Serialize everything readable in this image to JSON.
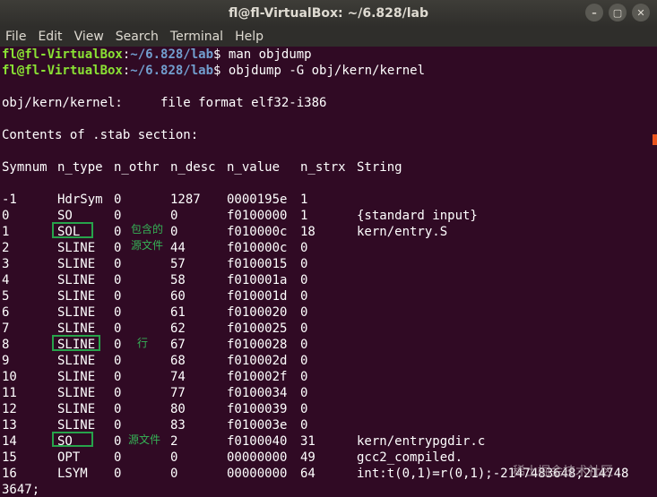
{
  "window": {
    "title": "fl@fl-VirtualBox: ~/6.828/lab",
    "controls": [
      "–",
      "▢",
      "✕"
    ]
  },
  "menu": [
    "File",
    "Edit",
    "View",
    "Search",
    "Terminal",
    "Help"
  ],
  "prompt": {
    "user": "fl@fl-VirtualBox",
    "sep": ":",
    "path": "~/6.828/lab",
    "symbol": "$"
  },
  "commands": [
    "man objdump",
    "objdump -G obj/kern/kernel"
  ],
  "output": {
    "file_line": "obj/kern/kernel:     file format elf32-i386",
    "section_line": "Contents of .stab section:",
    "headers": [
      "Symnum",
      "n_type",
      "n_othr",
      "n_desc",
      "n_value",
      "n_strx",
      "String"
    ],
    "rows": [
      [
        "-1",
        "HdrSym",
        "0",
        "1287",
        "0000195e",
        "1",
        ""
      ],
      [
        "0",
        "SO",
        "0",
        "0",
        "f0100000",
        "1",
        "{standard input}"
      ],
      [
        "1",
        "SOL",
        "0",
        "0",
        "f010000c",
        "18",
        "kern/entry.S"
      ],
      [
        "2",
        "SLINE",
        "0",
        "44",
        "f010000c",
        "0",
        ""
      ],
      [
        "3",
        "SLINE",
        "0",
        "57",
        "f0100015",
        "0",
        ""
      ],
      [
        "4",
        "SLINE",
        "0",
        "58",
        "f010001a",
        "0",
        ""
      ],
      [
        "5",
        "SLINE",
        "0",
        "60",
        "f010001d",
        "0",
        ""
      ],
      [
        "6",
        "SLINE",
        "0",
        "61",
        "f0100020",
        "0",
        ""
      ],
      [
        "7",
        "SLINE",
        "0",
        "62",
        "f0100025",
        "0",
        ""
      ],
      [
        "8",
        "SLINE",
        "0",
        "67",
        "f0100028",
        "0",
        ""
      ],
      [
        "9",
        "SLINE",
        "0",
        "68",
        "f010002d",
        "0",
        ""
      ],
      [
        "10",
        "SLINE",
        "0",
        "74",
        "f010002f",
        "0",
        ""
      ],
      [
        "11",
        "SLINE",
        "0",
        "77",
        "f0100034",
        "0",
        ""
      ],
      [
        "12",
        "SLINE",
        "0",
        "80",
        "f0100039",
        "0",
        ""
      ],
      [
        "13",
        "SLINE",
        "0",
        "83",
        "f010003e",
        "0",
        ""
      ],
      [
        "14",
        "SO",
        "0",
        "2",
        "f0100040",
        "31",
        "kern/entrypgdir.c"
      ],
      [
        "15",
        "OPT",
        "0",
        "0",
        "00000000",
        "49",
        "gcc2_compiled."
      ],
      [
        "16",
        "LSYM",
        "0",
        "0",
        "00000000",
        "64",
        "int:t(0,1)=r(0,1);-2147483648;214748"
      ]
    ],
    "wrap_line": "3647;"
  },
  "annotations": {
    "note_sol_1": "包含的",
    "note_sol_2": "源文件",
    "note_sline": "行",
    "note_so": "源文件"
  },
  "watermark": "稀土掘金技术社区",
  "colors": {
    "background": "#300a24",
    "prompt_user": "#8ae234",
    "prompt_path": "#729fcf",
    "annotation": "#27a34b"
  }
}
